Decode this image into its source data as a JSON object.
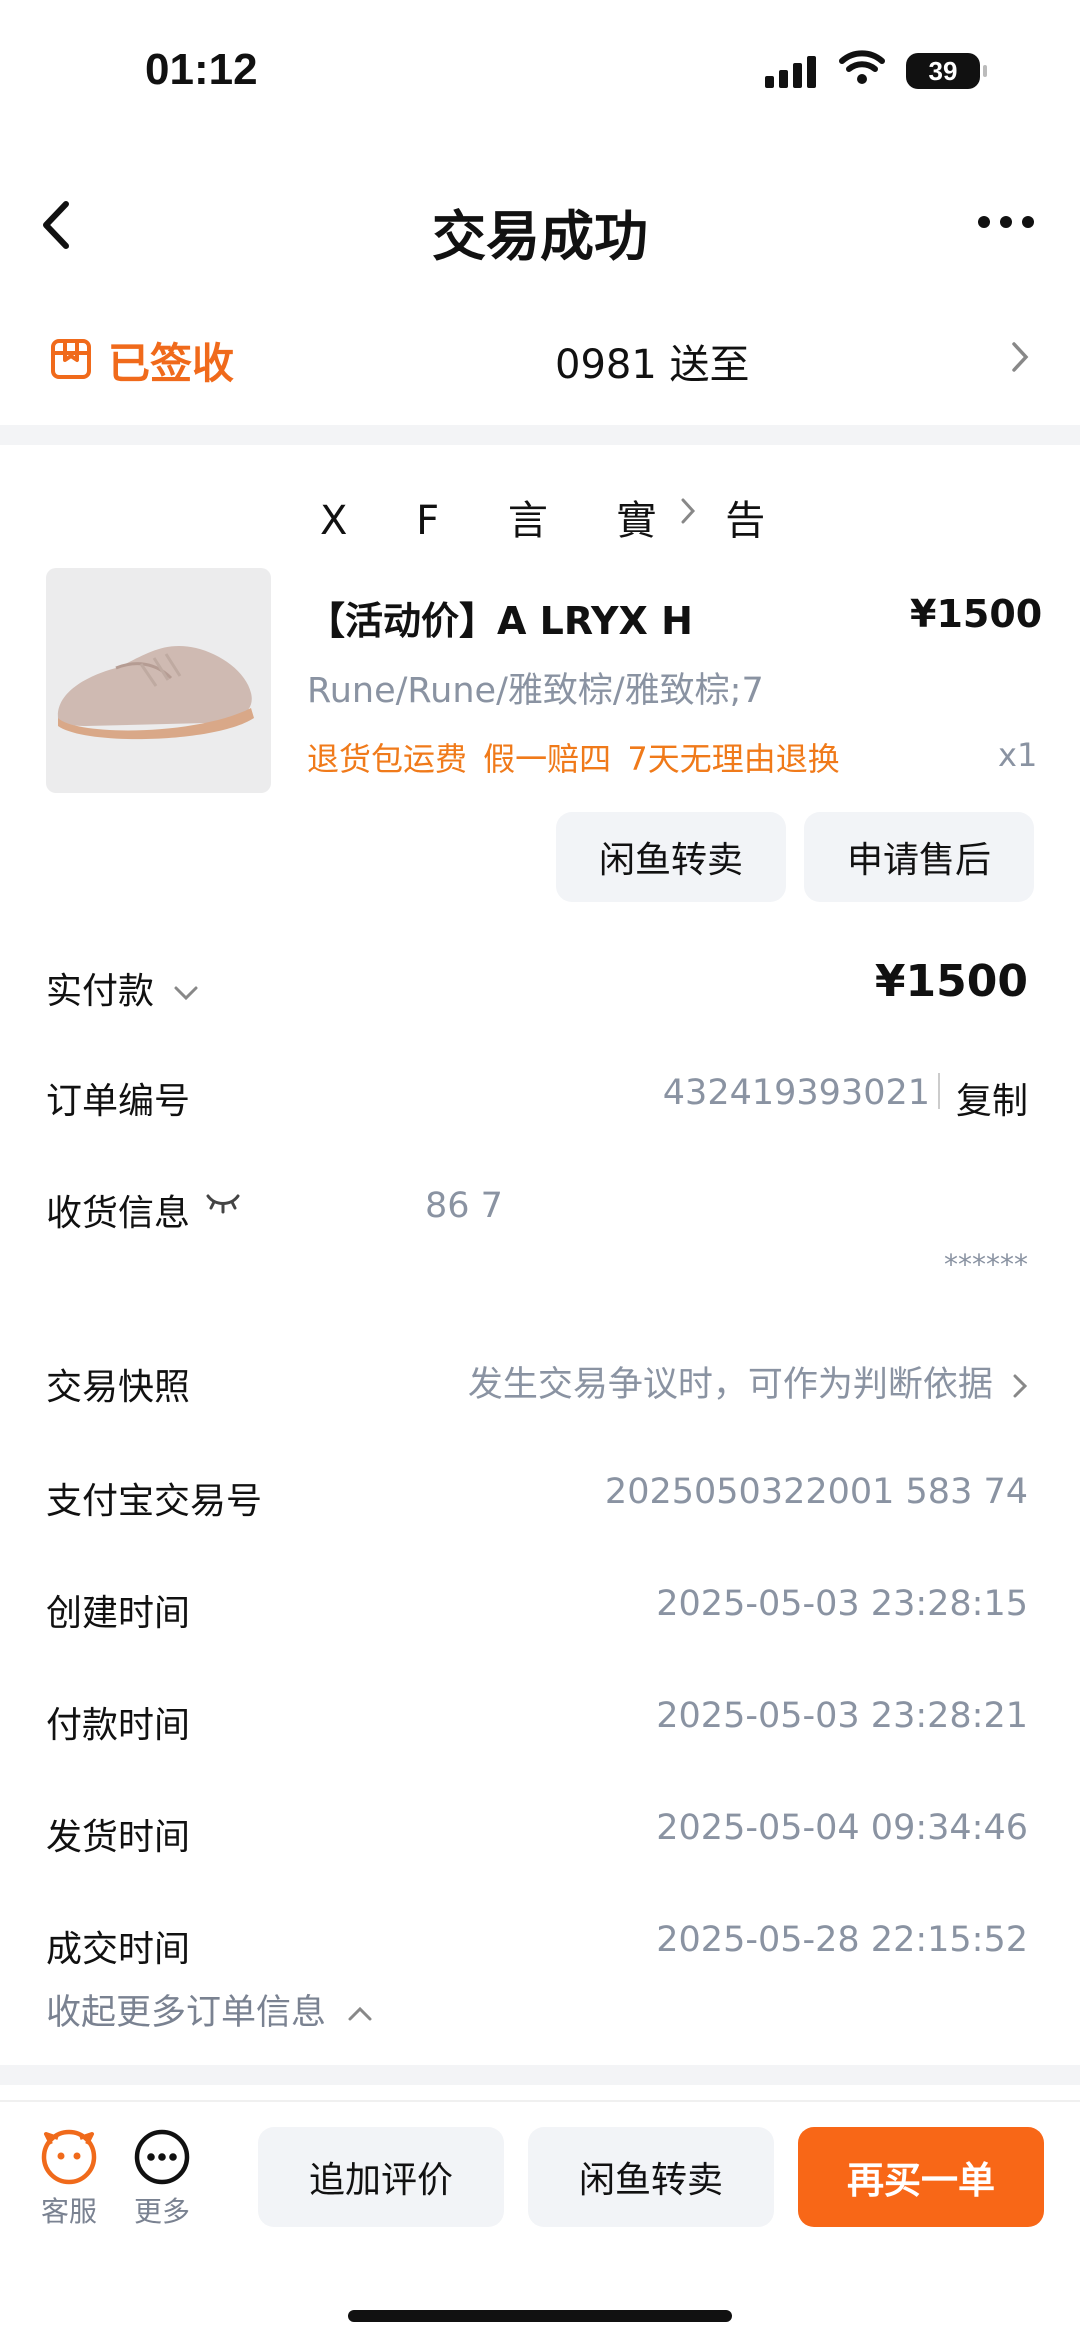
{
  "status_bar": {
    "time": "01:12",
    "battery": "39"
  },
  "nav": {
    "title": "交易成功"
  },
  "delivery": {
    "status": "已签收",
    "text": "0981 送至"
  },
  "shop": {
    "name": "X F 言 實 告"
  },
  "product": {
    "title": "【活动价】A   LRYX   H",
    "price": "¥1500",
    "spec": "Rune/Rune/雅致棕/雅致棕;7",
    "tags": "退货包运费 假一赔四 7天无理由退换",
    "qty": "x1",
    "btn_resell": "闲鱼转卖",
    "btn_aftersale": "申请售后"
  },
  "order": {
    "paid_label": "实付款",
    "paid_value": "¥1500",
    "order_no_label": "订单编号",
    "order_no_value": "432419393021",
    "copy_label": "复制",
    "receiver_label": "收货信息",
    "receiver_value": "86   7",
    "receiver_masked": "******",
    "snapshot_label": "交易快照",
    "snapshot_value": "发生交易争议时，可作为判断依据",
    "alipay_label": "支付宝交易号",
    "alipay_value": "2025050322001   583   74",
    "created_label": "创建时间",
    "created_value": "2025-05-03 23:28:15",
    "paid_time_label": "付款时间",
    "paid_time_value": "2025-05-03 23:28:21",
    "shipped_label": "发货时间",
    "shipped_value": "2025-05-04 09:34:46",
    "deal_label": "成交时间",
    "deal_value": "2025-05-28 22:15:52",
    "collapse_label": "收起更多订单信息"
  },
  "bottom": {
    "service_label": "客服",
    "more_label": "更多",
    "btn_review": "追加评价",
    "btn_resell": "闲鱼转卖",
    "btn_rebuy": "再买一单"
  },
  "colors": {
    "accent": "#f06a1b",
    "muted": "#8a93a2",
    "button_bg": "#f2f4f7"
  }
}
